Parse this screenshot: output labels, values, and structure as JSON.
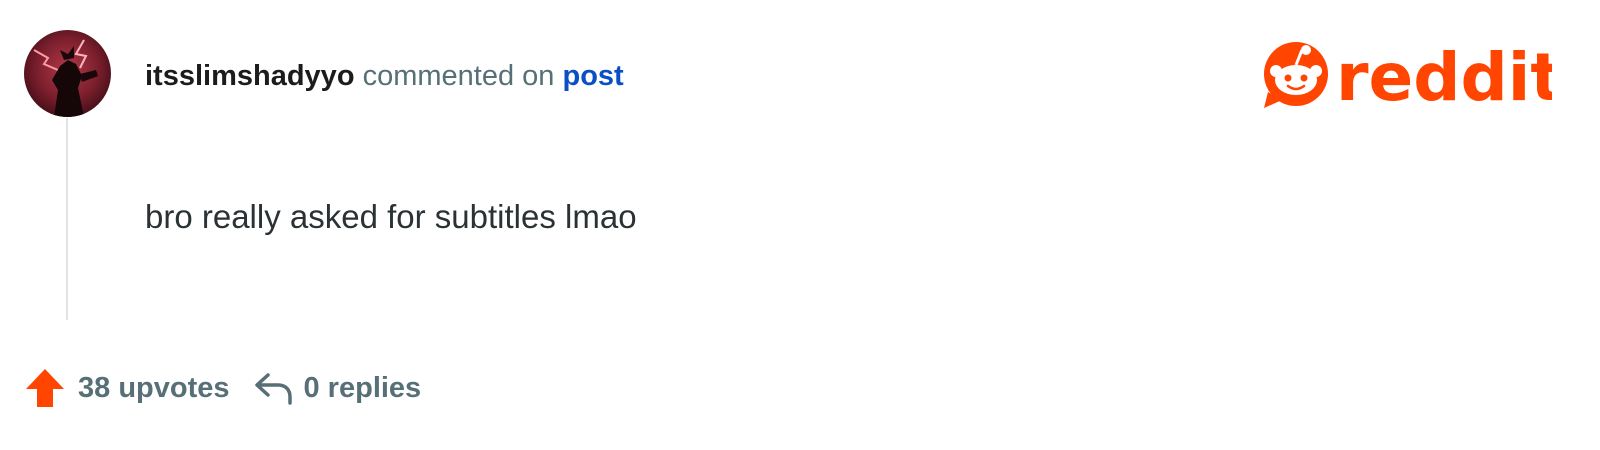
{
  "comment": {
    "author": "itsslimshadyyo",
    "action_text": "commented on",
    "target_link": "post",
    "body": "bro really asked for subtitles lmao"
  },
  "stats": {
    "upvotes_label": "38 upvotes",
    "replies_label": "0 replies"
  },
  "brand": {
    "logo_text": "reddit",
    "color": "#ff4500"
  },
  "icons": {
    "avatar": "user-avatar-image",
    "upvote": "arrow-up-icon",
    "reply": "reply-arrow-icon",
    "logo": "reddit-snoo-logo-icon"
  },
  "colors": {
    "text_primary": "#1c1c1c",
    "text_secondary": "#576f76",
    "link": "#0a4fc4",
    "thread_line": "#dfe3e6"
  }
}
